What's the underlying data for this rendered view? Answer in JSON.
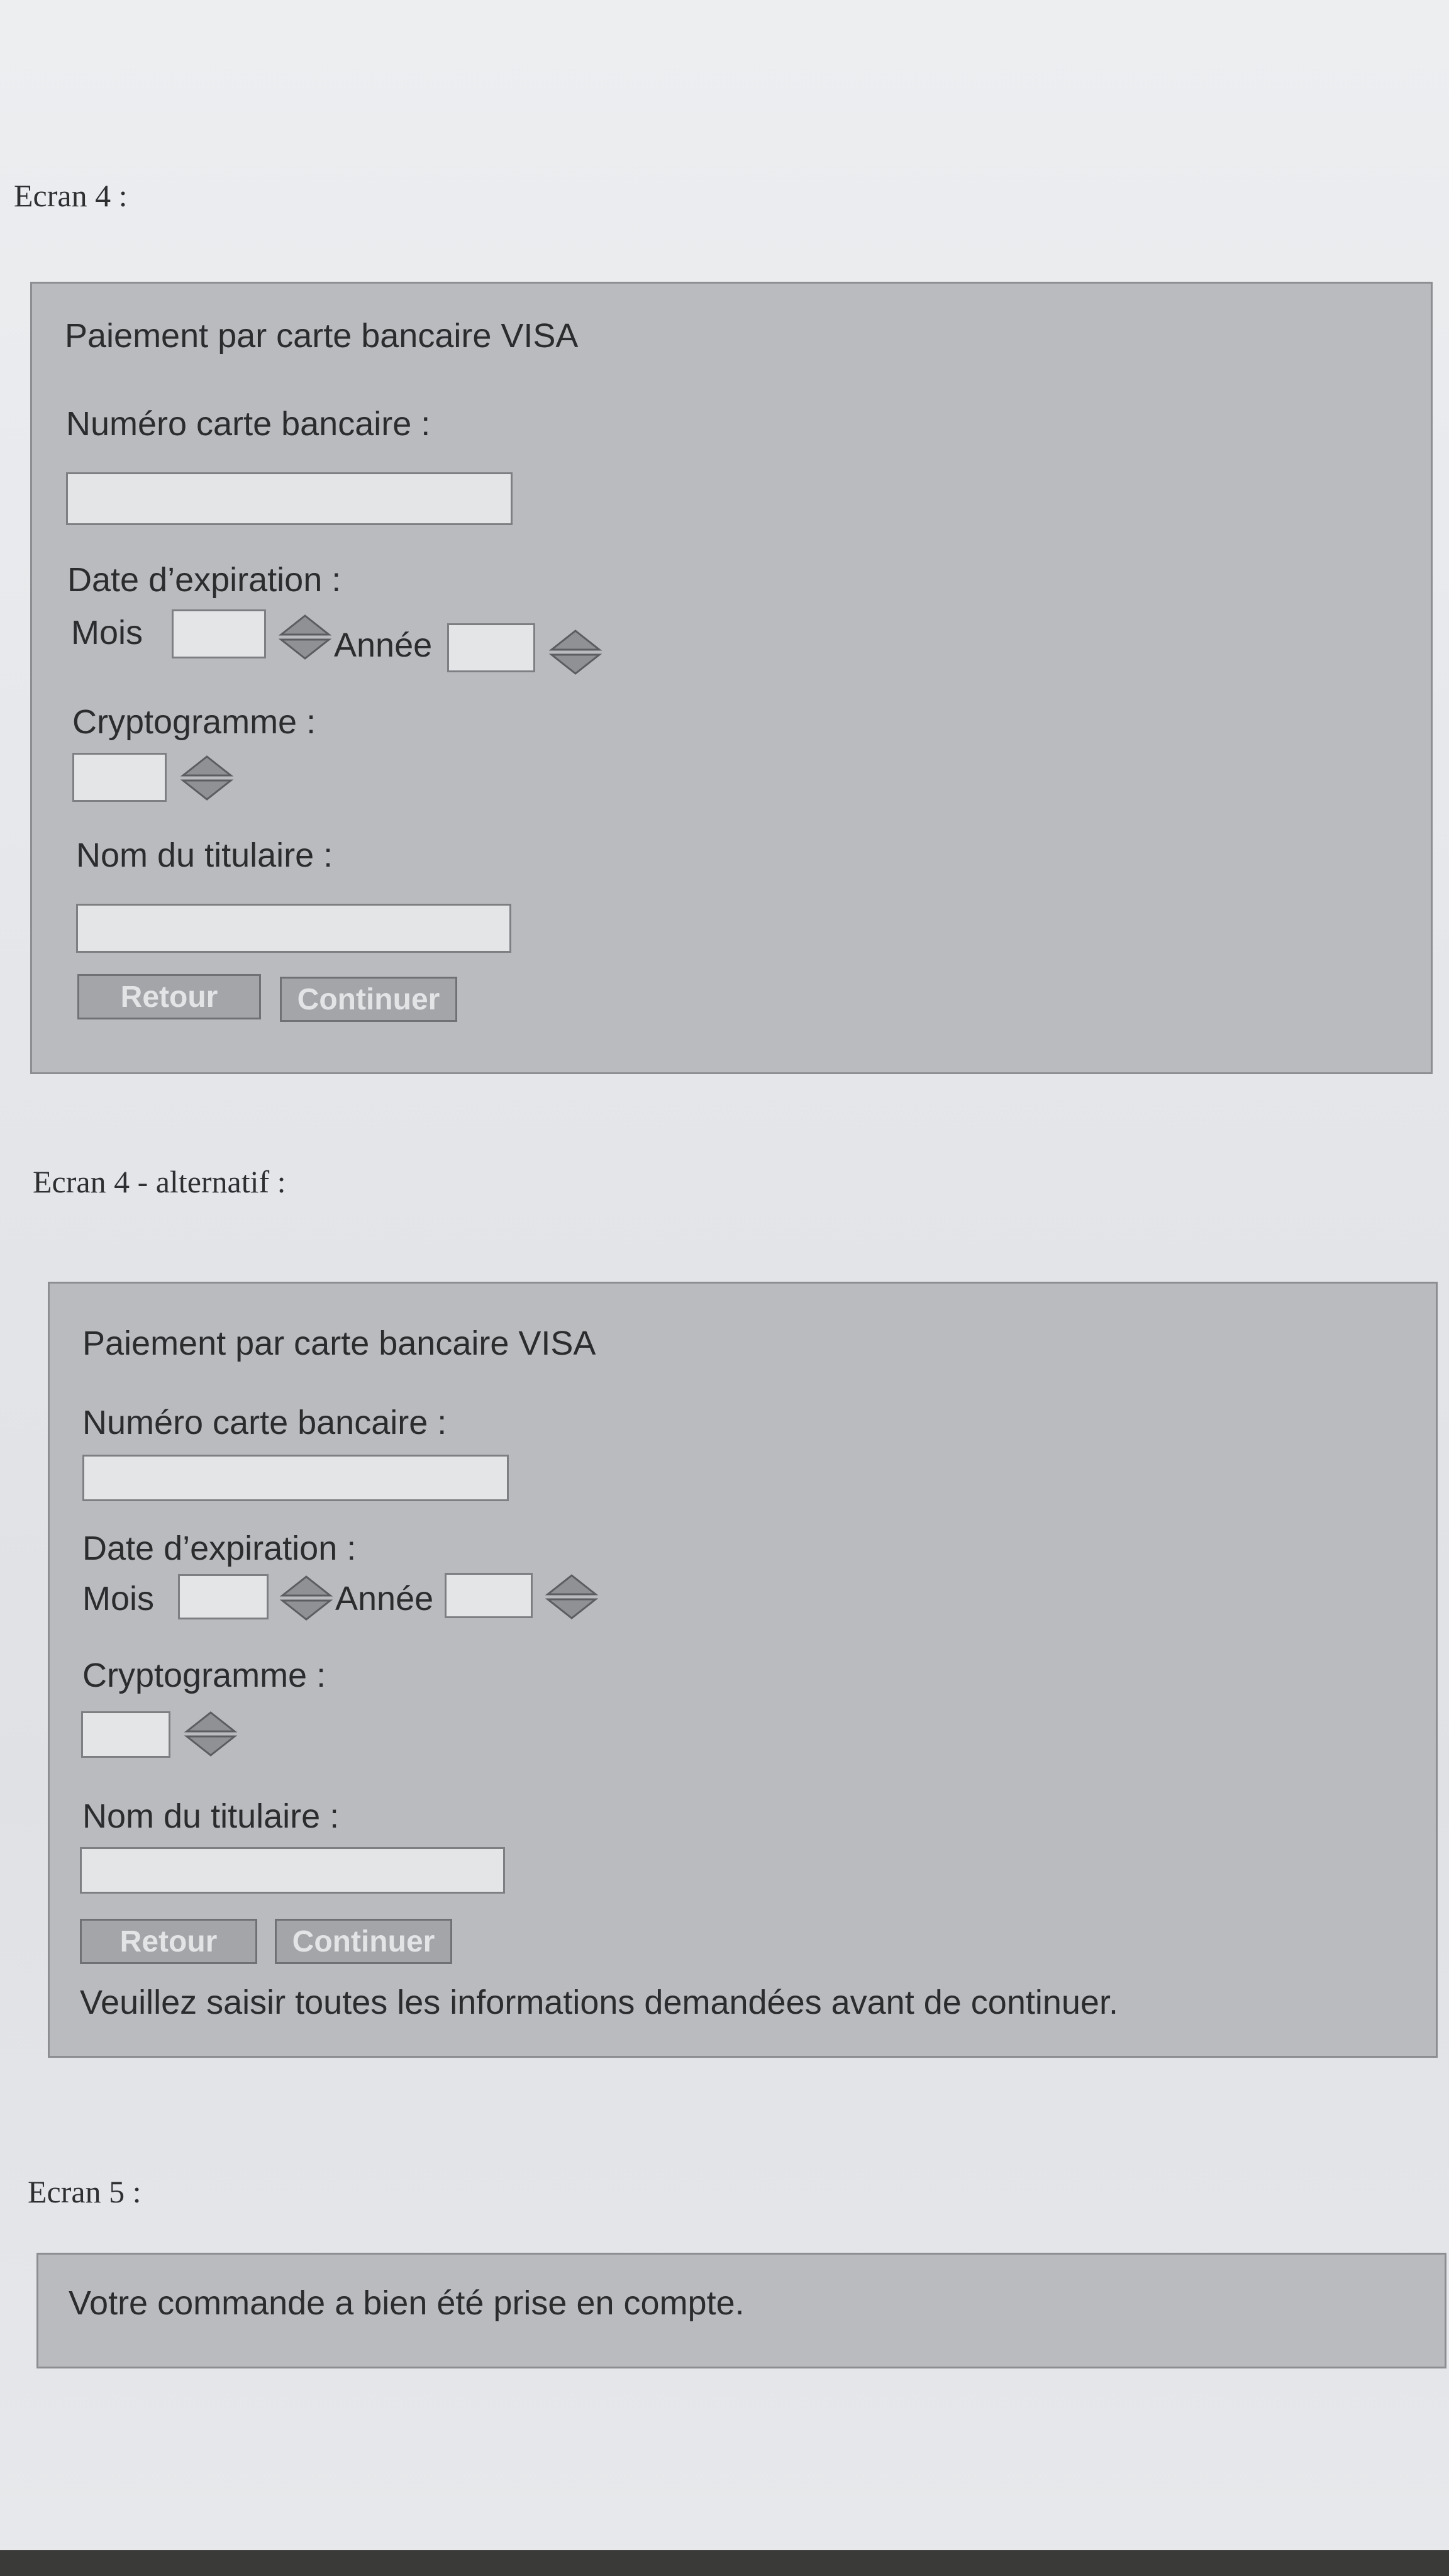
{
  "screens": [
    {
      "heading": "Ecran 4 :",
      "title": "Paiement par carte bancaire VISA",
      "card_number_label": "Numéro carte bancaire :",
      "expiry_label": "Date d’expiration :",
      "month_label": "Mois",
      "year_label": "Année",
      "cvv_label": "Cryptogramme :",
      "holder_label": "Nom du titulaire :",
      "back_button": "Retour",
      "continue_button": "Continuer"
    },
    {
      "heading": "Ecran 4 - alternatif :",
      "title": "Paiement par carte bancaire VISA",
      "card_number_label": "Numéro carte bancaire :",
      "expiry_label": "Date d’expiration :",
      "month_label": "Mois",
      "year_label": "Année",
      "cvv_label": "Cryptogramme :",
      "holder_label": "Nom du titulaire :",
      "back_button": "Retour",
      "continue_button": "Continuer",
      "error_message": "Veuillez saisir toutes les informations demandées avant de continuer."
    },
    {
      "heading": "Ecran 5 :",
      "message": "Votre commande a bien été prise en compte."
    }
  ]
}
